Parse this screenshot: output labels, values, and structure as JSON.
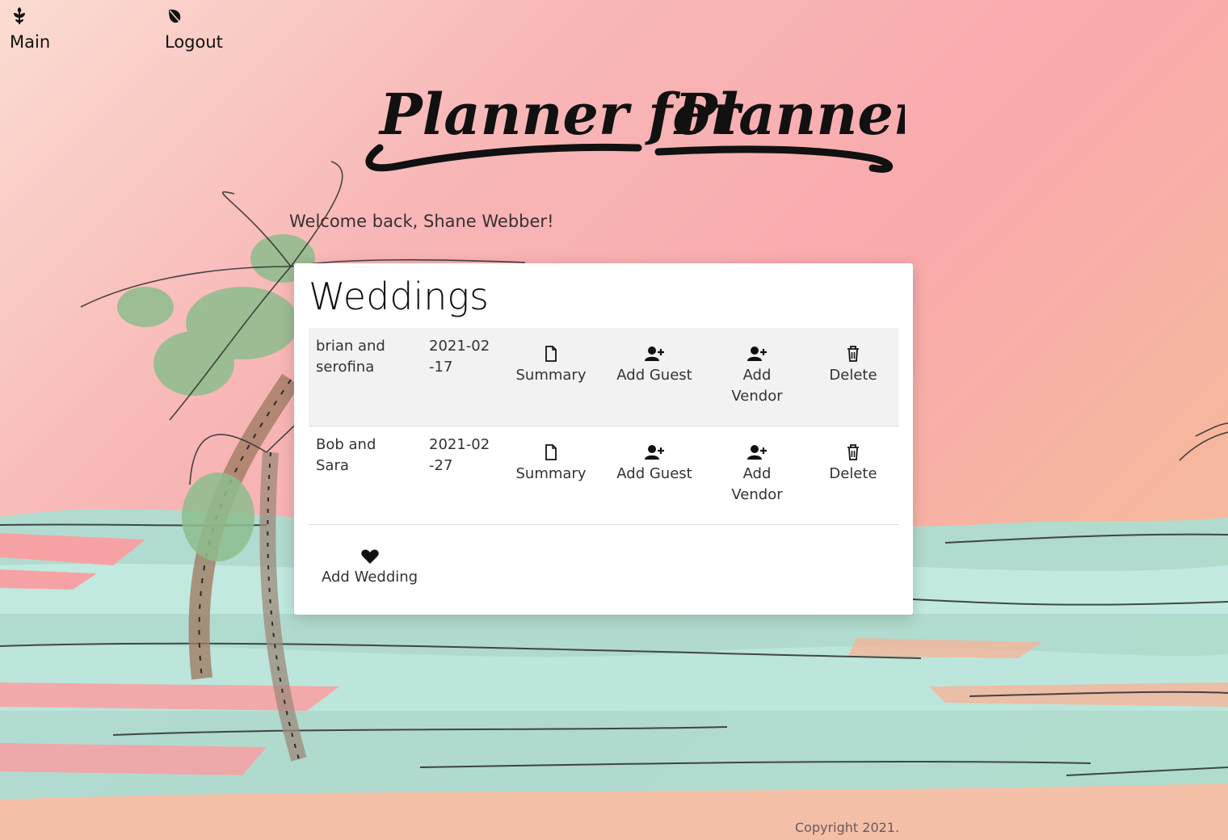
{
  "nav": {
    "items": [
      {
        "label": "Main",
        "icon": "leaf-sprig-icon"
      },
      {
        "label": "Logout",
        "icon": "leaf-icon"
      }
    ]
  },
  "header": {
    "logo_text_1": "Planner for",
    "logo_text_2": "Planners"
  },
  "welcome": "Welcome back, Shane Webber!",
  "weddings": {
    "title": "Weddings",
    "rows": [
      {
        "name": "brian and serofina",
        "date": "2021-02-17"
      },
      {
        "name": "Bob and Sara",
        "date": "2021-02-27"
      }
    ],
    "actions": {
      "summary": "Summary",
      "add_guest": "Add Guest",
      "add_vendor": "Add Vendor",
      "delete": "Delete"
    },
    "add_wedding": "Add Wedding"
  },
  "footer": {
    "copyright": "Copyright 2021."
  },
  "colors": {
    "accent": "#111111",
    "bg_pink": "#f9aaad",
    "sea": "#a9dfd3"
  }
}
